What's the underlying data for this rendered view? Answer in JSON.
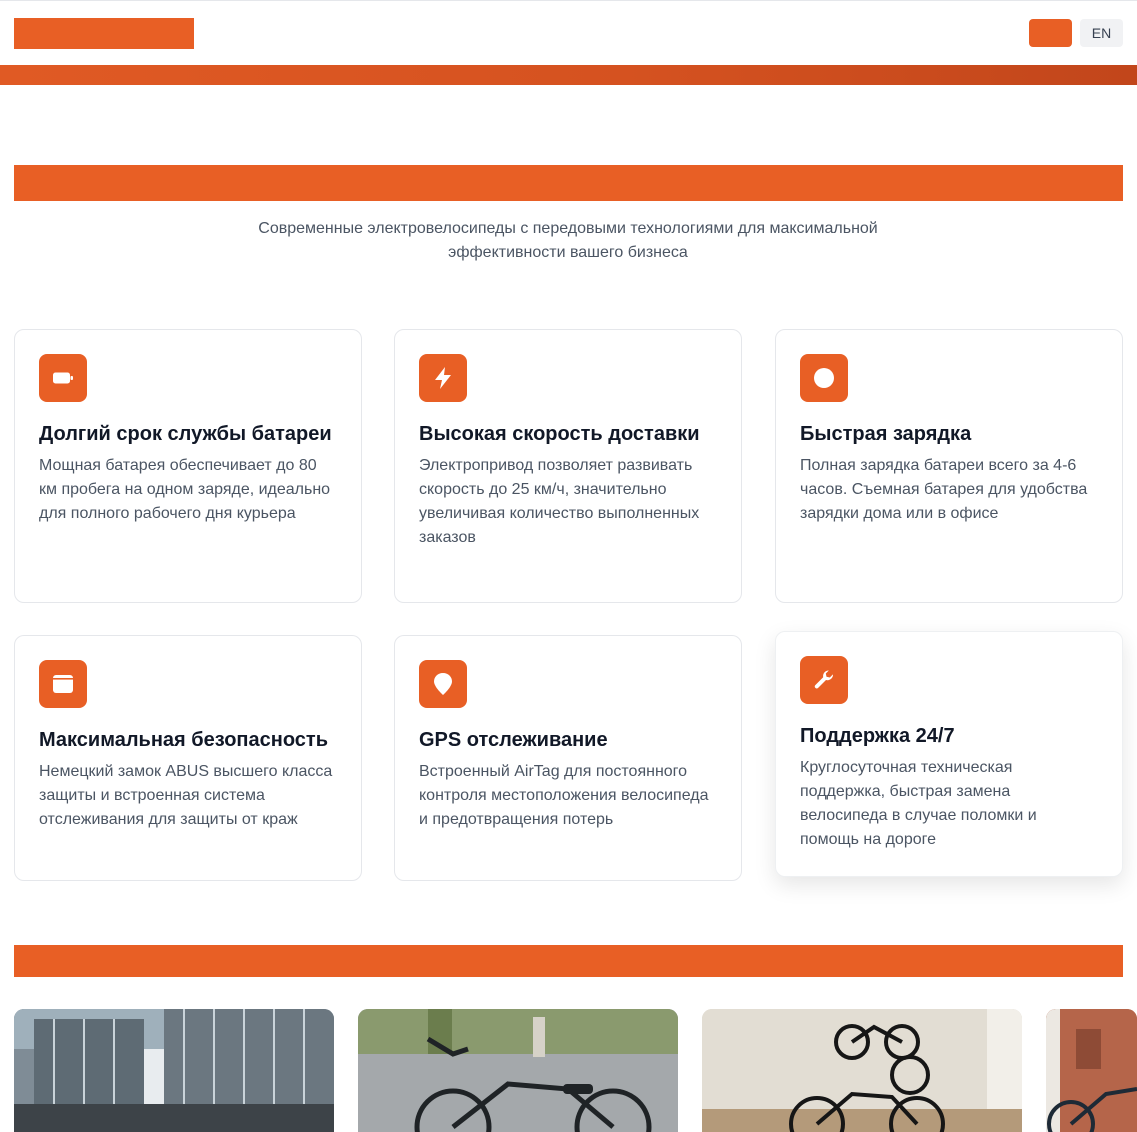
{
  "header": {
    "language_active": "",
    "language_en": "EN"
  },
  "features": {
    "subtitle": "Современные электровелосипеды с передовыми технологиями для максимальной эффективности вашего бизнеса",
    "cards": [
      {
        "icon": "battery-icon",
        "title": "Долгий срок службы батареи",
        "text": "Мощная батарея обеспечивает до 80 км пробега на одном заряде, идеально для полного рабочего дня курьера"
      },
      {
        "icon": "lightning-icon",
        "title": "Высокая скорость доставки",
        "text": "Электропривод позволяет развивать скорость до 25 км/ч, значительно увеличивая количество выполненных заказов"
      },
      {
        "icon": "clock-icon",
        "title": "Быстрая зарядка",
        "text": "Полная зарядка батареи всего за 4-6 часов. Съемная батарея для удобства зарядки дома или в офисе"
      },
      {
        "icon": "lock-icon",
        "title": "Максимальная безопасность",
        "text": "Немецкий замок ABUS высшего класса защиты и встроенная система отслеживания для защиты от краж"
      },
      {
        "icon": "location-pin-icon",
        "title": "GPS отслеживание",
        "text": "Встроенный AirTag для постоянного контроля местоположения велосипеда и предотвращения потерь"
      },
      {
        "icon": "wrench-icon",
        "title": "Поддержка 24/7",
        "text": "Круглосуточная техническая поддержка, быстрая замена велосипеда в случае поломки и помощь на дороге"
      }
    ]
  },
  "colors": {
    "accent": "#e85f25",
    "text_dark": "#111827",
    "text_muted": "#4b5563",
    "border": "#e5e7eb"
  },
  "gallery": {
    "photos": [
      "bikes-at-office-building-photo",
      "bike-on-square-photo",
      "bikes-indoor-wall-photo",
      "bikes-partial-photo"
    ]
  }
}
